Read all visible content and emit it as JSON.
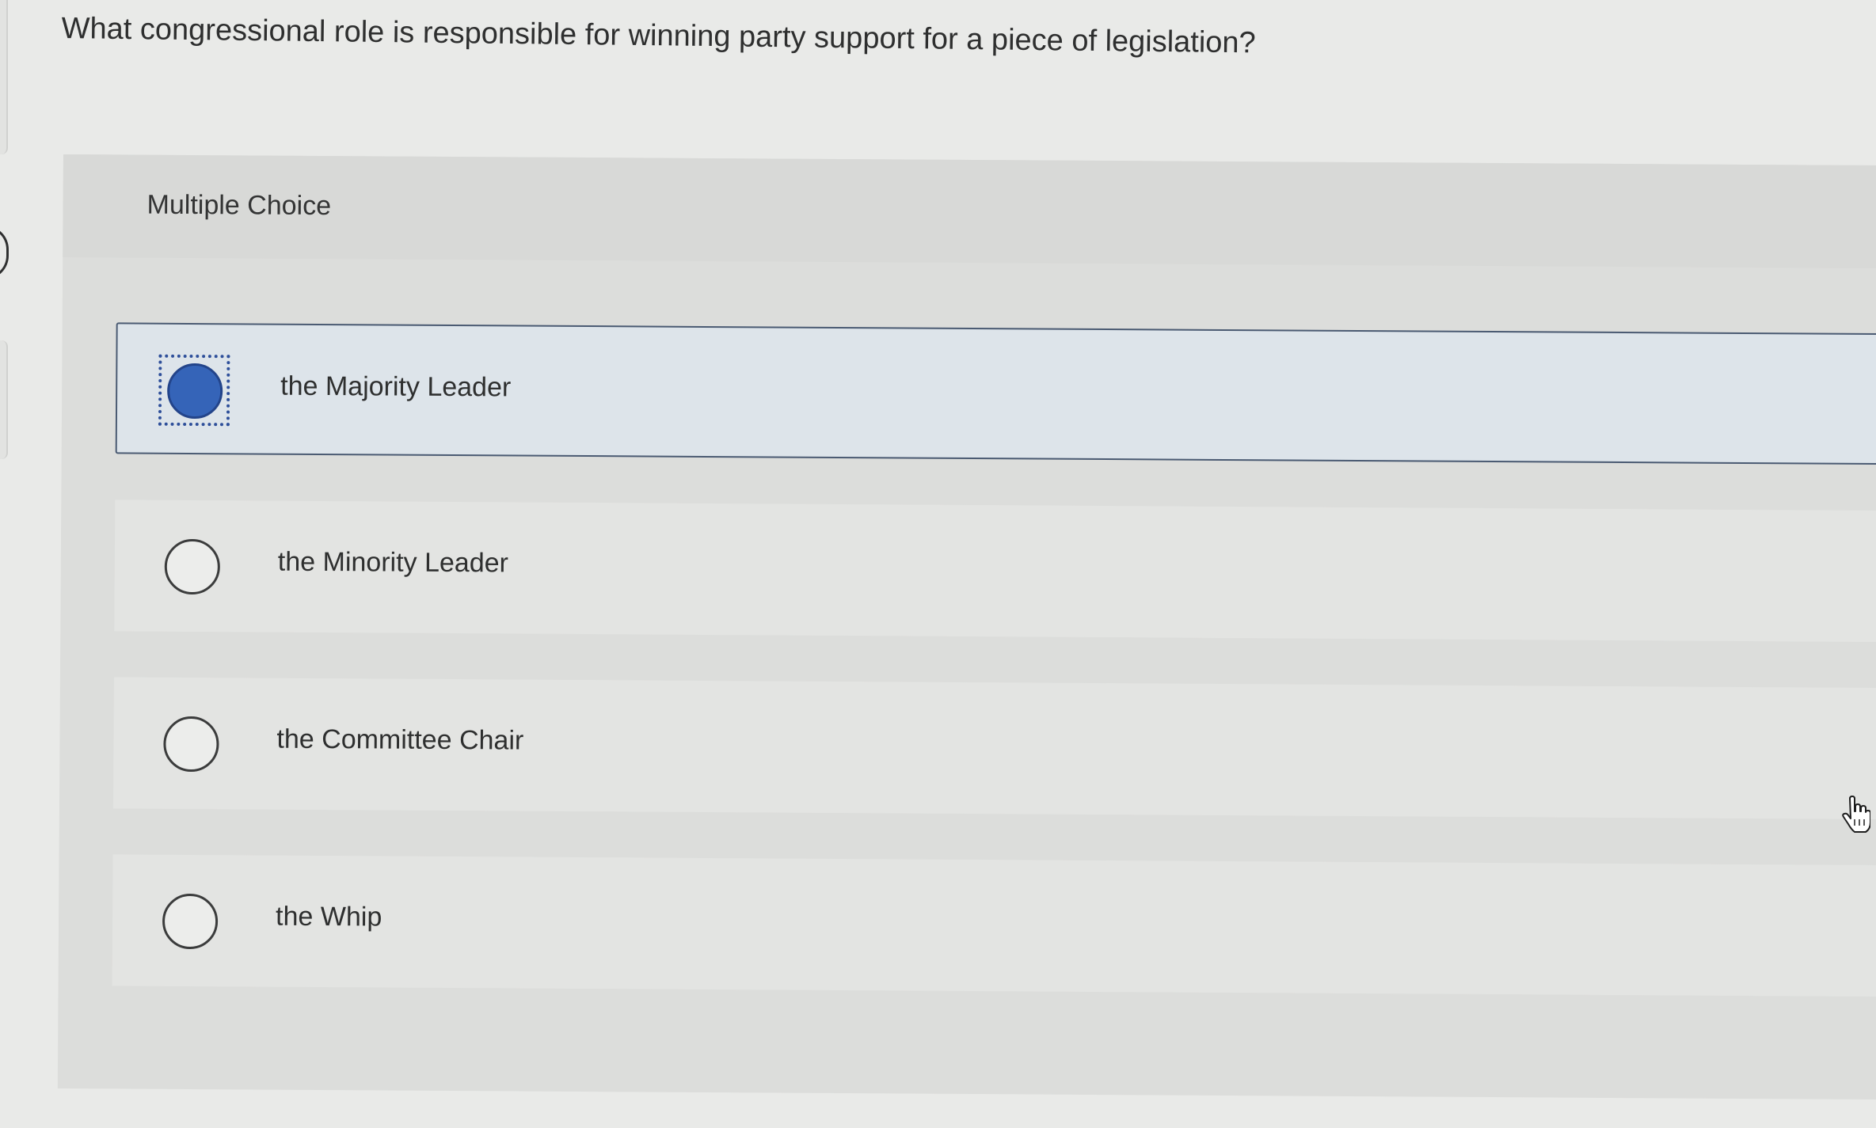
{
  "question": "What congressional role is responsible for winning party support for a piece of legislation?",
  "header": {
    "label": "Multiple Choice"
  },
  "options": [
    {
      "label": "the Majority Leader",
      "selected": true
    },
    {
      "label": "the Minority Leader",
      "selected": false
    },
    {
      "label": "the Committee Chair",
      "selected": false
    },
    {
      "label": "the Whip",
      "selected": false
    }
  ],
  "colors": {
    "accent": "#3564b8",
    "selected_bg": "#dde4ea",
    "selected_border": "#4a5a72",
    "panel_bg": "#dcdddb",
    "page_bg": "#e9eae8"
  },
  "icons": {
    "cursor": "hand-pointer-icon",
    "radio": "radio-button-icon"
  }
}
